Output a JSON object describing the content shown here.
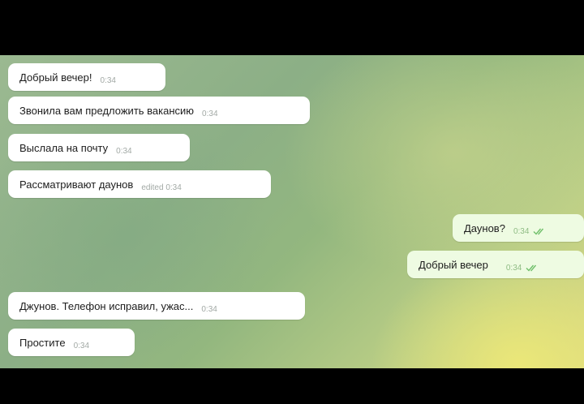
{
  "messages": [
    {
      "side": "in",
      "text": "Добрый вечер!",
      "time": "0:34"
    },
    {
      "side": "in",
      "text": "Звонила вам предложить вакансию",
      "time": "0:34"
    },
    {
      "side": "in",
      "text": "Выслала на почту",
      "time": "0:34"
    },
    {
      "side": "in",
      "text": "Рассматривают даунов",
      "time": "edited 0:34"
    },
    {
      "side": "out",
      "text": "Даунов?",
      "time": "0:34",
      "status": "read"
    },
    {
      "side": "out",
      "text": "Добрый вечер",
      "time": "0:34",
      "status": "read"
    },
    {
      "side": "in",
      "text": "Джунов. Телефон исправил, ужас...",
      "time": "0:34"
    },
    {
      "side": "in",
      "text": "Простите",
      "time": "0:34"
    }
  ],
  "icons": {
    "read_status": "double-check-icon"
  },
  "colors": {
    "incoming_bubble": "#ffffff",
    "outgoing_bubble": "#eefbe2",
    "check": "#6fbf6a"
  }
}
